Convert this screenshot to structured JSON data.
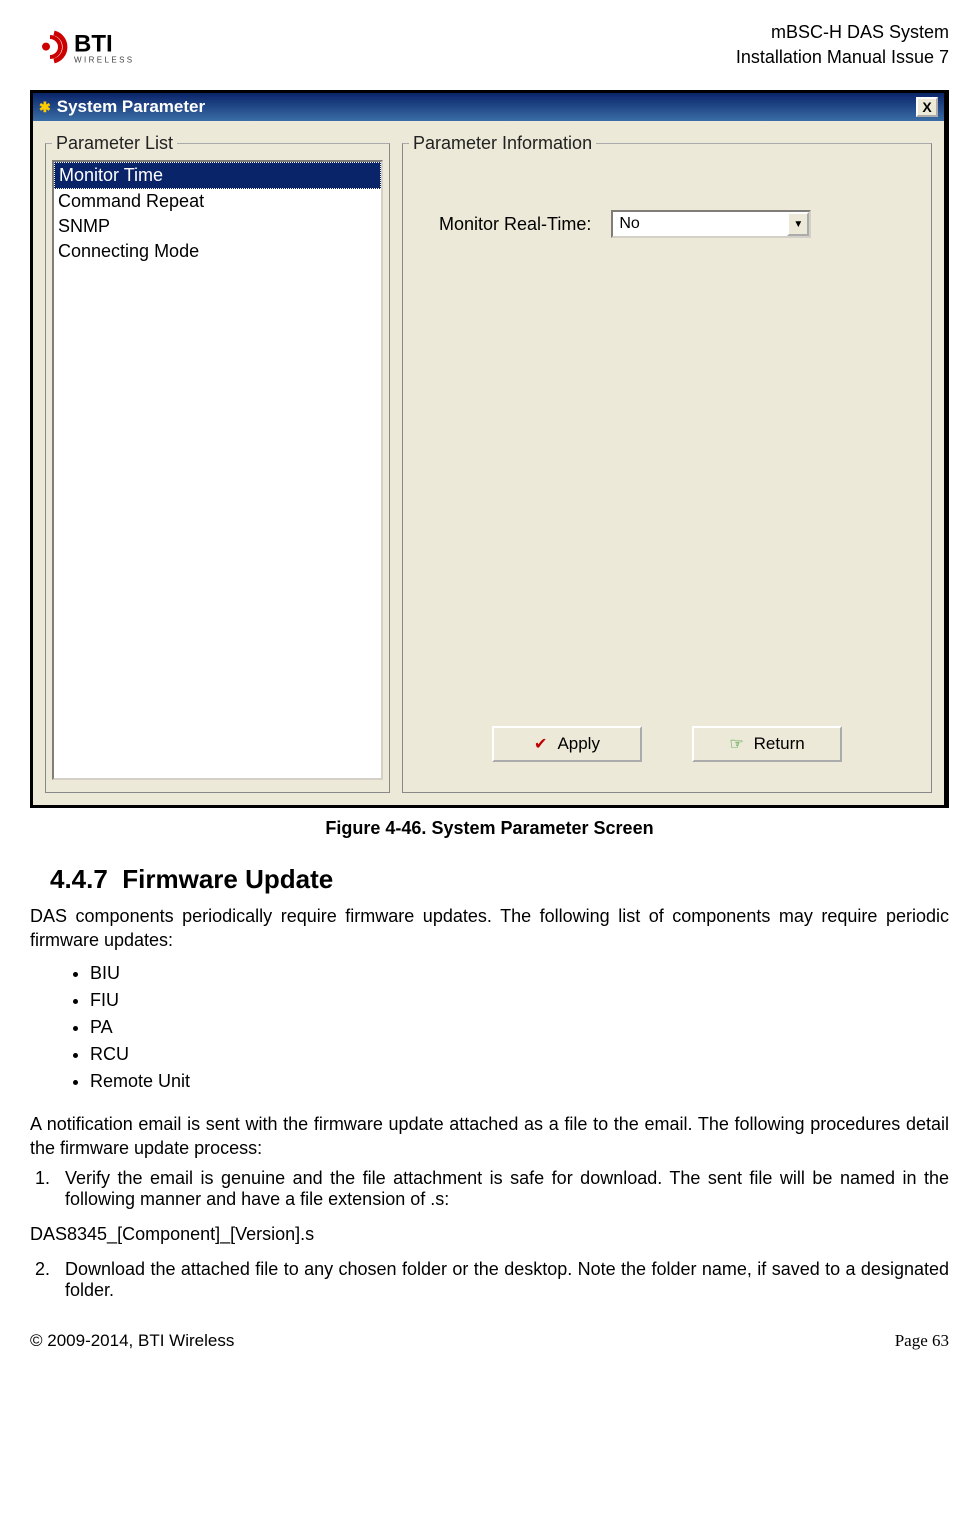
{
  "header": {
    "logo_alt": "BTI Wireless",
    "line1": "mBSC-H DAS System",
    "line2": "Installation Manual Issue 7"
  },
  "window": {
    "title": "System Parameter",
    "close_label": "X",
    "param_list_legend": "Parameter List",
    "param_info_legend": "Parameter Information",
    "list_items": [
      "Monitor Time",
      "Command Repeat",
      "SNMP",
      "Connecting Mode"
    ],
    "field_label": "Monitor Real-Time:",
    "field_value": "No",
    "apply_label": "Apply",
    "return_label": "Return"
  },
  "figure_caption": "Figure 4-46. System Parameter Screen",
  "section": {
    "number": "4.4.7",
    "title": "Firmware Update",
    "intro": "DAS components periodically require firmware updates. The following list of components may require periodic firmware updates:",
    "bullets": [
      "BIU",
      "FIU",
      "PA",
      "RCU",
      "Remote Unit"
    ],
    "para2": "A notification email is sent with the firmware update attached as a file to the email. The following procedures detail the firmware update process:",
    "step1": "Verify the email is genuine and the file attachment is safe for download. The sent file will be named in the following manner and have a file extension of .s:",
    "filename": "DAS8345_[Component]_[Version].s",
    "step2": "Download the attached file to any chosen folder or the desktop. Note the folder name, if saved to a designated folder."
  },
  "footer": {
    "copyright": "© 2009-2014, BTI Wireless",
    "page_label": "Page",
    "page_number": "63"
  }
}
